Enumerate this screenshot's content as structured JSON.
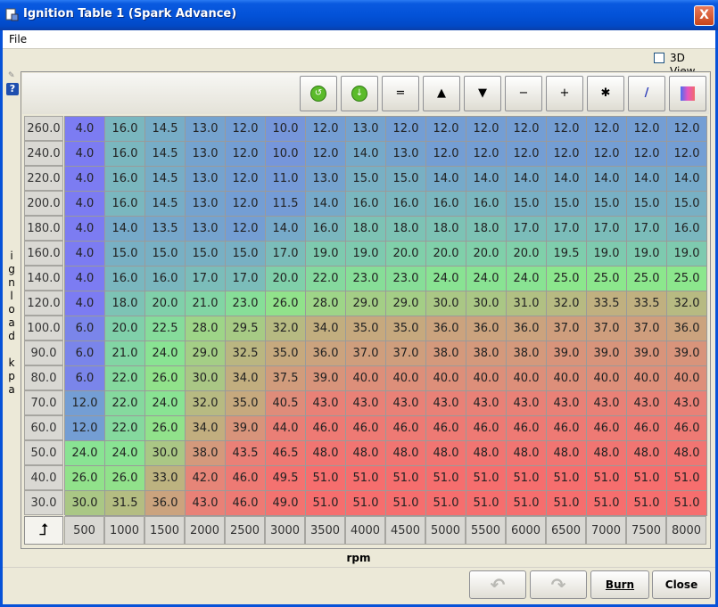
{
  "window": {
    "title": "Ignition Table 1 (Spark Advance)",
    "close_glyph": "X"
  },
  "menu": {
    "file_label": "File"
  },
  "view3d": {
    "label": "3D View",
    "checked": false
  },
  "toolbar": [
    {
      "name": "undo-green-button",
      "icon": "circle-arrow-left-icon",
      "glyph": "↺"
    },
    {
      "name": "redo-green-button",
      "icon": "circle-arrow-down-icon",
      "glyph": "↓"
    },
    {
      "name": "set-equal-button",
      "icon": "equals-icon",
      "glyph": "="
    },
    {
      "name": "increase-button",
      "icon": "triangle-up-icon",
      "glyph": "▲"
    },
    {
      "name": "decrease-button",
      "icon": "triangle-down-icon",
      "glyph": "▼"
    },
    {
      "name": "subtract-button",
      "icon": "minus-icon",
      "glyph": "−"
    },
    {
      "name": "add-button",
      "icon": "plus-icon",
      "glyph": "+"
    },
    {
      "name": "multiply-button",
      "icon": "asterisk-icon",
      "glyph": "✱"
    },
    {
      "name": "interpolate-button",
      "icon": "pen-icon",
      "glyph": "/"
    },
    {
      "name": "color-shade-button",
      "icon": "gradient-icon",
      "glyph": ""
    }
  ],
  "y_axis": {
    "label_chars": [
      "i",
      "g",
      "n",
      "l",
      "o",
      "a",
      "d",
      "",
      "k",
      "p",
      "a"
    ],
    "values": [
      "260.0",
      "240.0",
      "220.0",
      "200.0",
      "180.0",
      "160.0",
      "140.0",
      "120.0",
      "100.0",
      "90.0",
      "80.0",
      "70.0",
      "60.0",
      "50.0",
      "40.0",
      "30.0"
    ]
  },
  "x_axis": {
    "label": "rpm",
    "values": [
      "500",
      "1000",
      "1500",
      "2000",
      "2500",
      "3000",
      "3500",
      "4000",
      "4500",
      "5000",
      "5500",
      "6000",
      "6500",
      "7000",
      "7500",
      "8000"
    ]
  },
  "table": [
    [
      "4.0",
      "16.0",
      "14.5",
      "13.0",
      "12.0",
      "10.0",
      "12.0",
      "13.0",
      "12.0",
      "12.0",
      "12.0",
      "12.0",
      "12.0",
      "12.0",
      "12.0",
      "12.0"
    ],
    [
      "4.0",
      "16.0",
      "14.5",
      "13.0",
      "12.0",
      "10.0",
      "12.0",
      "14.0",
      "13.0",
      "12.0",
      "12.0",
      "12.0",
      "12.0",
      "12.0",
      "12.0",
      "12.0"
    ],
    [
      "4.0",
      "16.0",
      "14.5",
      "13.0",
      "12.0",
      "11.0",
      "13.0",
      "15.0",
      "15.0",
      "14.0",
      "14.0",
      "14.0",
      "14.0",
      "14.0",
      "14.0",
      "14.0"
    ],
    [
      "4.0",
      "16.0",
      "14.5",
      "13.0",
      "12.0",
      "11.5",
      "14.0",
      "16.0",
      "16.0",
      "16.0",
      "16.0",
      "15.0",
      "15.0",
      "15.0",
      "15.0",
      "15.0"
    ],
    [
      "4.0",
      "14.0",
      "13.5",
      "13.0",
      "12.0",
      "14.0",
      "16.0",
      "18.0",
      "18.0",
      "18.0",
      "18.0",
      "17.0",
      "17.0",
      "17.0",
      "17.0",
      "16.0"
    ],
    [
      "4.0",
      "15.0",
      "15.0",
      "15.0",
      "15.0",
      "17.0",
      "19.0",
      "19.0",
      "20.0",
      "20.0",
      "20.0",
      "20.0",
      "19.5",
      "19.0",
      "19.0",
      "19.0"
    ],
    [
      "4.0",
      "16.0",
      "16.0",
      "17.0",
      "17.0",
      "20.0",
      "22.0",
      "23.0",
      "23.0",
      "24.0",
      "24.0",
      "24.0",
      "25.0",
      "25.0",
      "25.0",
      "25.0"
    ],
    [
      "4.0",
      "18.0",
      "20.0",
      "21.0",
      "23.0",
      "26.0",
      "28.0",
      "29.0",
      "29.0",
      "30.0",
      "30.0",
      "31.0",
      "32.0",
      "33.5",
      "33.5",
      "32.0"
    ],
    [
      "6.0",
      "20.0",
      "22.5",
      "28.0",
      "29.5",
      "32.0",
      "34.0",
      "35.0",
      "35.0",
      "36.0",
      "36.0",
      "36.0",
      "37.0",
      "37.0",
      "37.0",
      "36.0"
    ],
    [
      "6.0",
      "21.0",
      "24.0",
      "29.0",
      "32.5",
      "35.0",
      "36.0",
      "37.0",
      "37.0",
      "38.0",
      "38.0",
      "38.0",
      "39.0",
      "39.0",
      "39.0",
      "39.0"
    ],
    [
      "6.0",
      "22.0",
      "26.0",
      "30.0",
      "34.0",
      "37.5",
      "39.0",
      "40.0",
      "40.0",
      "40.0",
      "40.0",
      "40.0",
      "40.0",
      "40.0",
      "40.0",
      "40.0"
    ],
    [
      "12.0",
      "22.0",
      "24.0",
      "32.0",
      "35.0",
      "40.5",
      "43.0",
      "43.0",
      "43.0",
      "43.0",
      "43.0",
      "43.0",
      "43.0",
      "43.0",
      "43.0",
      "43.0"
    ],
    [
      "12.0",
      "22.0",
      "26.0",
      "34.0",
      "39.0",
      "44.0",
      "46.0",
      "46.0",
      "46.0",
      "46.0",
      "46.0",
      "46.0",
      "46.0",
      "46.0",
      "46.0",
      "46.0"
    ],
    [
      "24.0",
      "24.0",
      "30.0",
      "38.0",
      "43.5",
      "46.5",
      "48.0",
      "48.0",
      "48.0",
      "48.0",
      "48.0",
      "48.0",
      "48.0",
      "48.0",
      "48.0",
      "48.0"
    ],
    [
      "26.0",
      "26.0",
      "33.0",
      "42.0",
      "46.0",
      "49.5",
      "51.0",
      "51.0",
      "51.0",
      "51.0",
      "51.0",
      "51.0",
      "51.0",
      "51.0",
      "51.0",
      "51.0"
    ],
    [
      "30.0",
      "31.5",
      "36.0",
      "43.0",
      "46.0",
      "49.0",
      "51.0",
      "51.0",
      "51.0",
      "51.0",
      "51.0",
      "51.0",
      "51.0",
      "51.0",
      "51.0",
      "51.0"
    ]
  ],
  "color_scale": {
    "min": 4,
    "max": 51
  },
  "buttons": {
    "undo_glyph": "↶",
    "redo_glyph": "↷",
    "burn_label": "Burn",
    "close_label": "Close"
  }
}
